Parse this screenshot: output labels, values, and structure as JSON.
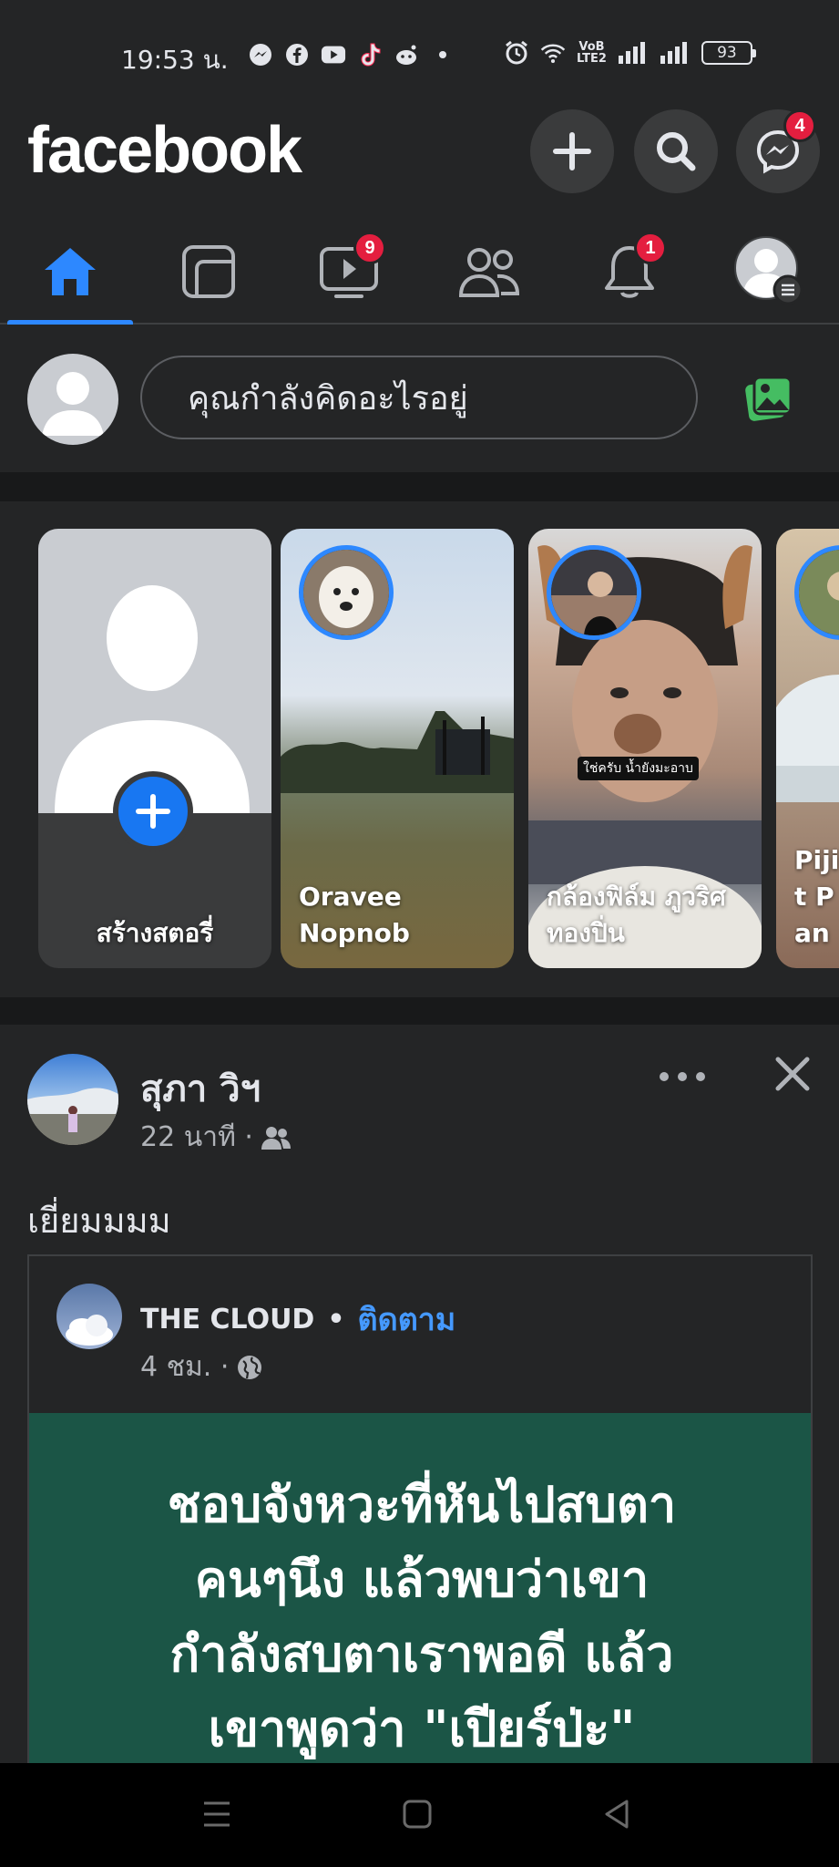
{
  "status_bar": {
    "time": "19:53 น.",
    "network_top": "VoB",
    "network_bottom": "LTE2",
    "battery": "93",
    "icons": [
      "messenger-icon",
      "facebook-icon",
      "youtube-icon",
      "tiktok-icon",
      "reddit-icon",
      "dot-icon",
      "alarm-icon",
      "wifi-icon",
      "signal-icon",
      "signal-icon"
    ]
  },
  "header": {
    "logo": "facebook",
    "messenger_badge": "4"
  },
  "tabs": {
    "items": [
      {
        "name": "home",
        "icon": "home-icon",
        "active": true
      },
      {
        "name": "pages",
        "icon": "pages-icon"
      },
      {
        "name": "watch",
        "icon": "video-icon",
        "badge": "9"
      },
      {
        "name": "groups",
        "icon": "friends-icon"
      },
      {
        "name": "notifications",
        "icon": "bell-icon",
        "badge": "1"
      },
      {
        "name": "menu",
        "icon": "profile-menu-icon"
      }
    ],
    "accent": "#2d88ff"
  },
  "composer": {
    "placeholder": "คุณกำลังคิดอะไรอยู่"
  },
  "stories": [
    {
      "label": "สร้างสตอรี่",
      "type": "create"
    },
    {
      "label": "Oravee Nopnob",
      "type": "story"
    },
    {
      "label": "กล้องฟิล์ม ภูวริศ ทองปิ่น",
      "type": "story",
      "sticker": "ใช่ครับ น้ำยังมะอาบ"
    },
    {
      "label": "Pijit Pan",
      "type": "story"
    }
  ],
  "post": {
    "author": "สุภา วิฯ",
    "time": "22 นาที ·",
    "audience_icon": "friends-icon",
    "text": "เยี่ยมมมม",
    "shared": {
      "page_name": "THE CLOUD",
      "dot": "•",
      "follow": "ติดตาม",
      "time": "4 ชม. ·",
      "audience_icon": "globe-icon",
      "quote": "ชอบจังหวะที่หันไปสบตา\nคนๆนึง แล้วพบว่าเขา\nกำลังสบตาเราพอดี แล้ว\nเขาพูดว่า \"เปียร์ป่ะ\"",
      "card_color": "#1b5546"
    }
  }
}
